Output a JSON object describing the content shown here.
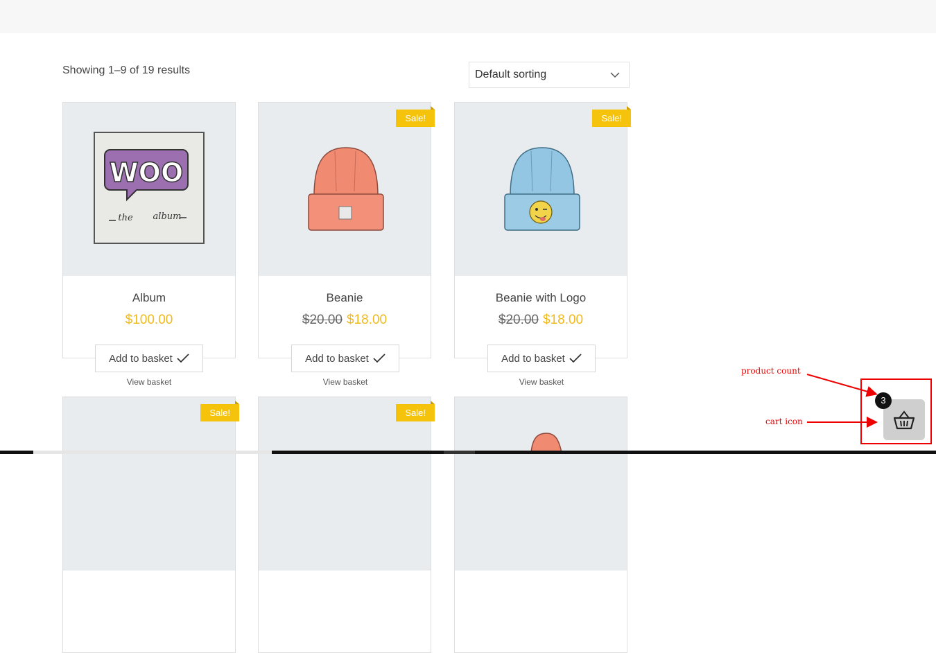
{
  "shop": {
    "result_count": "Showing 1–9 of 19 results",
    "sorting": {
      "selected": "Default sorting"
    }
  },
  "products": [
    {
      "title": "Album",
      "price": "$100.00",
      "old_price": "",
      "sale": false,
      "add_label": "Add to basket",
      "view_label": "View basket",
      "image_icon": "album-icon"
    },
    {
      "title": "Beanie",
      "price": "$18.00",
      "old_price": "$20.00",
      "sale": true,
      "sale_label": "Sale!",
      "add_label": "Add to basket",
      "view_label": "View basket",
      "image_icon": "beanie-icon"
    },
    {
      "title": "Beanie with Logo",
      "price": "$18.00",
      "old_price": "$20.00",
      "sale": true,
      "sale_label": "Sale!",
      "add_label": "Add to basket",
      "view_label": "View basket",
      "image_icon": "beanie-logo-icon"
    }
  ],
  "second_row": [
    {
      "sale_label": "Sale!"
    },
    {
      "sale_label": "Sale!"
    },
    {
      "image_icon": "cap-icon"
    }
  ],
  "album_art": {
    "main": "WOO",
    "sub_left": "the",
    "sub_right": "album"
  },
  "cart": {
    "count": "3",
    "icon": "basket-icon"
  },
  "annotations": {
    "product_count": "product count",
    "cart_icon": "cart icon"
  },
  "colors": {
    "accent": "#f5c30c",
    "price": "#f2b91c",
    "annotation": "#e00000"
  }
}
